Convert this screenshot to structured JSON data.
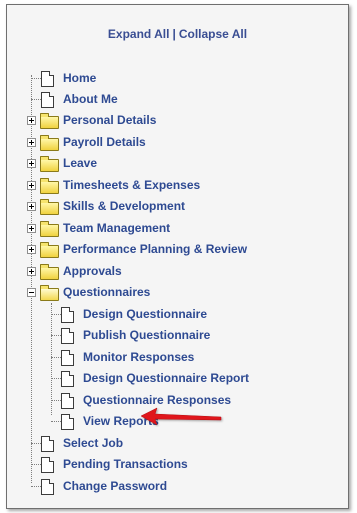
{
  "header": {
    "expand_all": "Expand All",
    "separator": "|",
    "collapse_all": "Collapse All"
  },
  "tree": {
    "home": "Home",
    "about_me": "About Me",
    "personal_details": "Personal Details",
    "payroll_details": "Payroll Details",
    "leave": "Leave",
    "timesheets_expenses": "Timesheets & Expenses",
    "skills_development": "Skills & Development",
    "team_management": "Team Management",
    "performance_planning_review": "Performance Planning & Review",
    "approvals": "Approvals",
    "questionnaires": {
      "label": "Questionnaires",
      "children": {
        "design_questionnaire": "Design Questionnaire",
        "publish_questionnaire": "Publish Questionnaire",
        "monitor_responses": "Monitor Responses",
        "design_questionnaire_report": "Design Questionnaire Report",
        "questionnaire_responses": "Questionnaire Responses",
        "view_reports": "View Reports"
      }
    },
    "select_job": "Select Job",
    "pending_transactions": "Pending Transactions",
    "change_password": "Change Password"
  },
  "colors": {
    "link_text": "#2e4a92",
    "arrow": "#e0141b",
    "panel_bg": "#f5f5f5"
  }
}
